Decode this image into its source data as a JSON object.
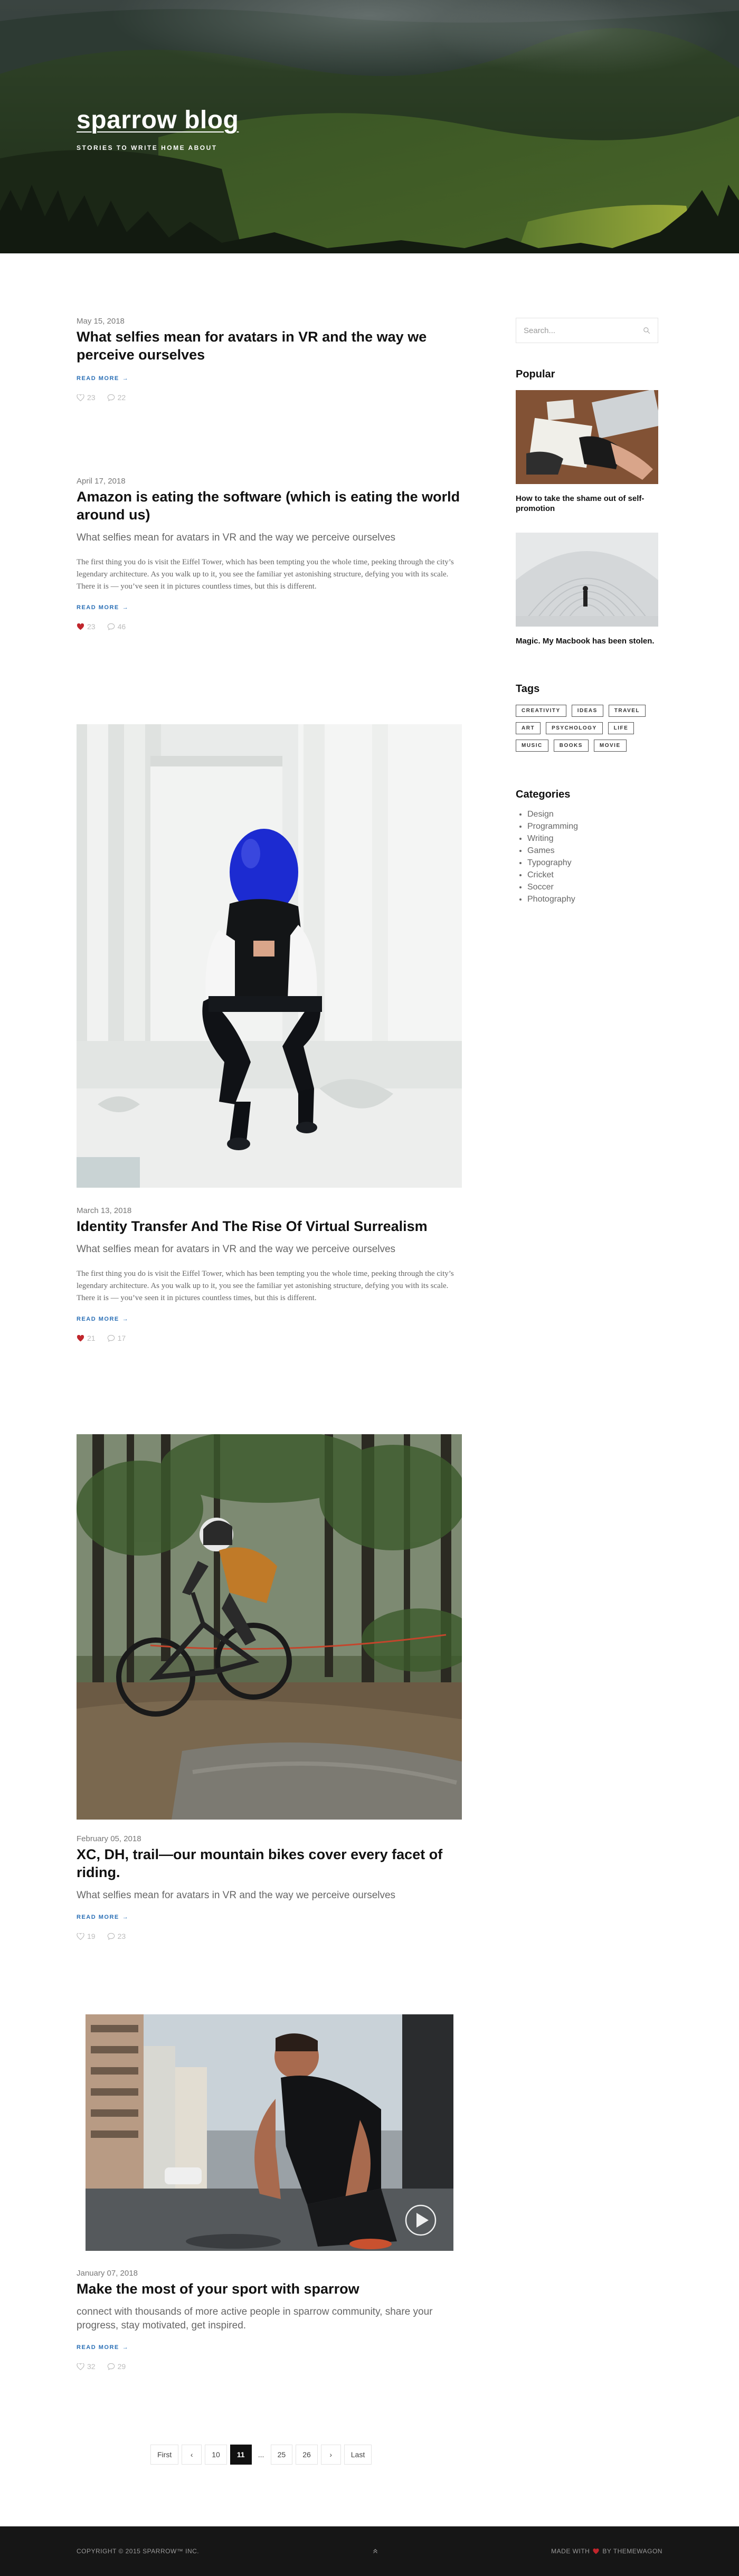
{
  "brand": {
    "title": "sparrow blog",
    "tagline": "STORIES TO WRITE HOME ABOUT"
  },
  "search": {
    "placeholder": "Search..."
  },
  "posts": [
    {
      "date": "May 15, 2018",
      "title": "What selfies mean for avatars in VR and the way we perceive ourselves",
      "read_more": "READ MORE",
      "likes": "23",
      "comments": "22",
      "liked": false
    },
    {
      "date": "April 17, 2018",
      "title": "Amazon is eating the software (which is eating the world around us)",
      "subtitle": "What selfies mean for avatars in VR and the way we perceive ourselves",
      "body": "The first thing you do is visit the Eiffel Tower, which has been tempting you the whole time, peeking through the city’s legendary architecture. As you walk up to it, you see the familiar yet astonishing structure, defying you with its scale. There it is — you’ve seen it in pictures countless times, but this is different.",
      "read_more": "READ MORE",
      "likes": "23",
      "comments": "46",
      "liked": true
    },
    {
      "date": "March 13, 2018",
      "title": "Identity Transfer And The Rise Of Virtual Surrealism",
      "subtitle": "What selfies mean for avatars in VR and the way we perceive ourselves",
      "body": "The first thing you do is visit the Eiffel Tower, which has been tempting you the whole time, peeking through the city’s legendary architecture. As you walk up to it, you see the familiar yet astonishing structure, defying you with its scale. There it is — you’ve seen it in pictures countless times, but this is different.",
      "read_more": "READ MORE",
      "likes": "21",
      "comments": "17",
      "liked": true
    },
    {
      "date": "February 05, 2018",
      "title": "XC, DH, trail—our mountain bikes cover every facet of riding.",
      "subtitle": "What selfies mean for avatars in VR and the way we perceive ourselves",
      "read_more": "READ MORE",
      "likes": "19",
      "comments": "23",
      "liked": false
    },
    {
      "date": "January 07, 2018",
      "title": "Make the most of your sport with sparrow",
      "subtitle": "connect with thousands of more active people in sparrow community, share your progress, stay motivated, get inspired.",
      "read_more": "READ MORE",
      "likes": "32",
      "comments": "29",
      "liked": false
    }
  ],
  "sidebar": {
    "popular_heading": "Popular",
    "popular": [
      {
        "caption": "How to take the shame out of self-promotion"
      },
      {
        "caption": "Magic. My Macbook has been stolen."
      }
    ],
    "tags_heading": "Tags",
    "tags": [
      "CREATIVITY",
      "IDEAS",
      "TRAVEL",
      "ART",
      "PSYCHOLOGY",
      "LIFE",
      "MUSIC",
      "BOOKS",
      "MOVIE"
    ],
    "categories_heading": "Categories",
    "categories": [
      "Design",
      "Programming",
      "Writing",
      "Games",
      "Typography",
      "Cricket",
      "Soccer",
      "Photography"
    ]
  },
  "pagination": {
    "first": "First",
    "prev": "‹",
    "pages": [
      "10",
      "11",
      "...",
      "25",
      "26"
    ],
    "active": "11",
    "next": "›",
    "last": "Last"
  },
  "footer": {
    "copyright": "COPYRIGHT © 2015 SPARROW™ INC.",
    "made_with": "MADE WITH",
    "by": "BY THEMEWAGON"
  },
  "colors": {
    "accent": "#2a6fb6",
    "heart": "#c0262c",
    "footer_bg": "#161616"
  }
}
